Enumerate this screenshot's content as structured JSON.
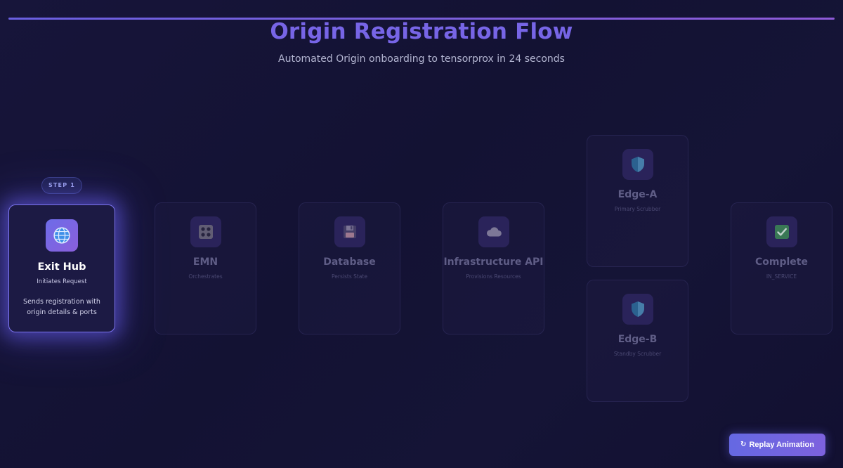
{
  "header": {
    "title": "Origin Registration Flow",
    "subtitle": "Automated Origin onboarding to tensorprox in 24 seconds"
  },
  "step_badge": "STEP 1",
  "nodes": [
    {
      "id": "exit-hub",
      "title": "Exit Hub",
      "subtitle": "Initiates Request",
      "description_lines": [
        "Sends registration with",
        "origin details & ports"
      ],
      "icon": "globe-icon",
      "active": true
    },
    {
      "id": "emn",
      "title": "EMN",
      "subtitle": "Orchestrates",
      "icon": "control-knobs-icon",
      "active": false
    },
    {
      "id": "database",
      "title": "Database",
      "subtitle": "Persists State",
      "icon": "floppy-disk-icon",
      "active": false
    },
    {
      "id": "infrastructure-api",
      "title": "Infrastructure API",
      "subtitle": "Provisions Resources",
      "icon": "cloud-icon",
      "active": false
    },
    {
      "id": "edge-a",
      "title": "Edge-A",
      "subtitle": "Primary Scrubber",
      "icon": "shield-icon",
      "active": false
    },
    {
      "id": "edge-b",
      "title": "Edge-B",
      "subtitle": "Standby Scrubber",
      "icon": "shield-icon",
      "active": false
    },
    {
      "id": "complete",
      "title": "Complete",
      "subtitle": "IN_SERVICE",
      "icon": "check-mark-icon",
      "active": false
    }
  ],
  "controls": {
    "replay_label": "Replay Animation",
    "replay_icon": "replay-icon"
  },
  "colors": {
    "background": "#141335",
    "accent": "#7765e6",
    "active_border": "#7c74ee",
    "button": "#6e66e0"
  }
}
